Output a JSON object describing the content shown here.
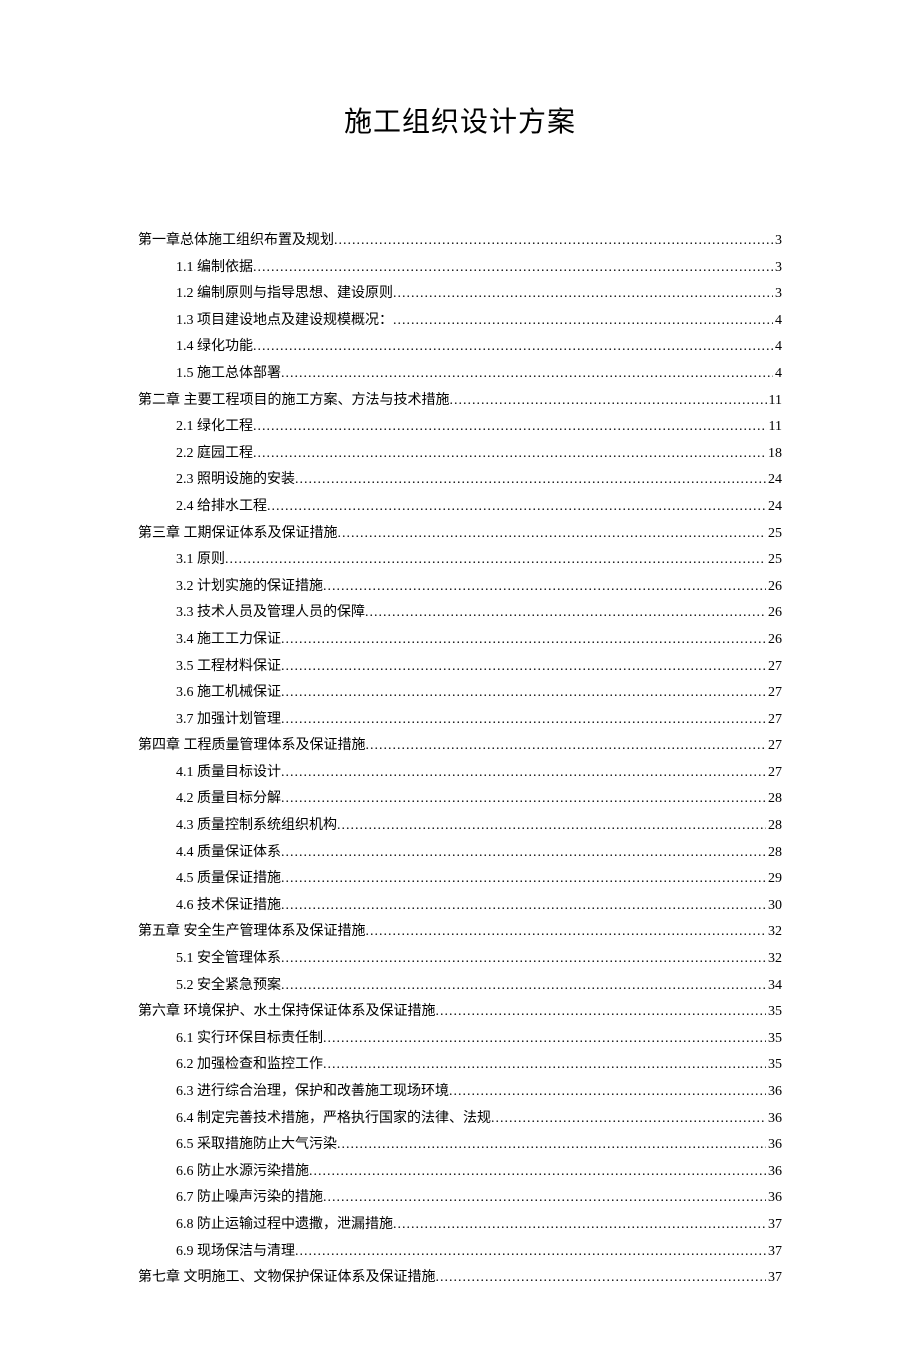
{
  "title": "施工组织设计方案",
  "toc": [
    {
      "level": 1,
      "label": "第一章总体施工组织布置及规划",
      "page": "3"
    },
    {
      "level": 2,
      "label": "1.1 编制依据",
      "page": "3"
    },
    {
      "level": 2,
      "label": "1.2 编制原则与指导思想、建设原则",
      "page": "3"
    },
    {
      "level": 2,
      "label": "1.3 项目建设地点及建设规模概况：",
      "page": "4"
    },
    {
      "level": 2,
      "label": "1.4 绿化功能",
      "page": "4"
    },
    {
      "level": 2,
      "label": "1.5 施工总体部署",
      "page": "4"
    },
    {
      "level": 1,
      "label": "第二章 主要工程项目的施工方案、方法与技术措施",
      "page": "11"
    },
    {
      "level": 2,
      "label": "2.1 绿化工程",
      "page": "11"
    },
    {
      "level": 2,
      "label": "2.2 庭园工程",
      "page": "18"
    },
    {
      "level": 2,
      "label": "2.3 照明设施的安装",
      "page": "24"
    },
    {
      "level": 2,
      "label": "2.4 给排水工程",
      "page": "24"
    },
    {
      "level": 1,
      "label": "第三章 工期保证体系及保证措施",
      "page": "25"
    },
    {
      "level": 2,
      "label": "3.1 原则",
      "page": "25"
    },
    {
      "level": 2,
      "label": "3.2 计划实施的保证措施",
      "page": "26"
    },
    {
      "level": 2,
      "label": "3.3 技术人员及管理人员的保障",
      "page": "26"
    },
    {
      "level": 2,
      "label": "3.4 施工工力保证",
      "page": "26"
    },
    {
      "level": 2,
      "label": "3.5 工程材料保证",
      "page": "27"
    },
    {
      "level": 2,
      "label": "3.6 施工机械保证",
      "page": "27"
    },
    {
      "level": 2,
      "label": "3.7 加强计划管理",
      "page": "27"
    },
    {
      "level": 1,
      "label": "第四章 工程质量管理体系及保证措施",
      "page": "27"
    },
    {
      "level": 2,
      "label": "4.1 质量目标设计",
      "page": "27"
    },
    {
      "level": 2,
      "label": "4.2 质量目标分解",
      "page": "28"
    },
    {
      "level": 2,
      "label": "4.3 质量控制系统组织机构",
      "page": "28"
    },
    {
      "level": 2,
      "label": "4.4 质量保证体系",
      "page": "28"
    },
    {
      "level": 2,
      "label": "4.5 质量保证措施",
      "page": "29"
    },
    {
      "level": 2,
      "label": "4.6 技术保证措施",
      "page": "30"
    },
    {
      "level": 1,
      "label": "第五章 安全生产管理体系及保证措施",
      "page": "32"
    },
    {
      "level": 2,
      "label": "5.1 安全管理体系",
      "page": "32"
    },
    {
      "level": 2,
      "label": "5.2 安全紧急预案",
      "page": "34"
    },
    {
      "level": 1,
      "label": "第六章 环境保护、水土保持保证体系及保证措施",
      "page": "35"
    },
    {
      "level": 2,
      "label": "6.1 实行环保目标责任制",
      "page": "35"
    },
    {
      "level": 2,
      "label": "6.2 加强检查和监控工作",
      "page": "35"
    },
    {
      "level": 2,
      "label": "6.3 进行综合治理，保护和改善施工现场环境",
      "page": "36"
    },
    {
      "level": 2,
      "label": "6.4 制定完善技术措施，严格执行国家的法律、法规",
      "page": "36"
    },
    {
      "level": 2,
      "label": "6.5 采取措施防止大气污染",
      "page": "36"
    },
    {
      "level": 2,
      "label": "6.6 防止水源污染措施",
      "page": "36"
    },
    {
      "level": 2,
      "label": "6.7 防止噪声污染的措施",
      "page": "36"
    },
    {
      "level": 2,
      "label": "6.8 防止运输过程中遗撒，泄漏措施",
      "page": "37"
    },
    {
      "level": 2,
      "label": "6.9 现场保洁与清理",
      "page": "37"
    },
    {
      "level": 1,
      "label": "第七章 文明施工、文物保护保证体系及保证措施",
      "page": "37"
    }
  ]
}
